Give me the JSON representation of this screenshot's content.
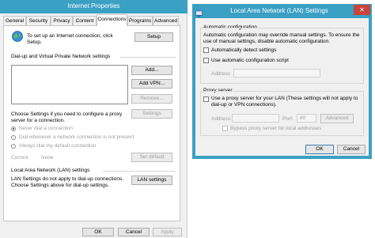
{
  "internet_properties": {
    "title": "Internet Properties",
    "tabs": [
      "General",
      "Security",
      "Privacy",
      "Content",
      "Connections",
      "Programs",
      "Advanced"
    ],
    "setup_text": "To set up an Internet connection, click Setup.",
    "setup_button": "Setup",
    "dialup_header": "Dial-up and Virtual Private Network settings",
    "add_button": "Add...",
    "add_vpn_button": "Add VPN...",
    "remove_button": "Remove...",
    "proxy_text": "Choose Settings if you need to configure a proxy server for a connection.",
    "settings_button": "Settings",
    "radio_never": "Never dial a connection",
    "radio_whenever": "Dial whenever a network connection is not present",
    "radio_always": "Always dial my default connection",
    "current_label": "Current",
    "current_value": "None",
    "set_default_button": "Set default",
    "lan_header": "Local Area Network (LAN) settings",
    "lan_text": "LAN Settings do not apply to dial-up connections. Choose Settings above for dial-up settings.",
    "lan_button": "LAN settings",
    "ok": "OK",
    "cancel": "Cancel",
    "apply": "Apply"
  },
  "lan_dialog": {
    "title": "Local Area Network (LAN) Settings",
    "auto_header": "Automatic configuration",
    "auto_desc": "Automatic configuration may override manual settings. To ensure the use of manual settings, disable automatic configuration.",
    "auto_detect": "Automatically detect settings",
    "use_script": "Use automatic configuration script",
    "address_label": "Address",
    "proxy_header": "Proxy server",
    "use_proxy": "Use a proxy server for your LAN (These settings will not apply to dial-up or VPN connections).",
    "proxy_address_label": "Address:",
    "port_label": "Port:",
    "port_value": "80",
    "advanced_button": "Advanced",
    "bypass": "Bypass proxy server for local addresses",
    "ok": "OK",
    "cancel": "Cancel"
  },
  "colors": {
    "titlebar": "#3aa0c4",
    "accent": "#3c7fb1",
    "window_bg": "#f0f0f0"
  }
}
